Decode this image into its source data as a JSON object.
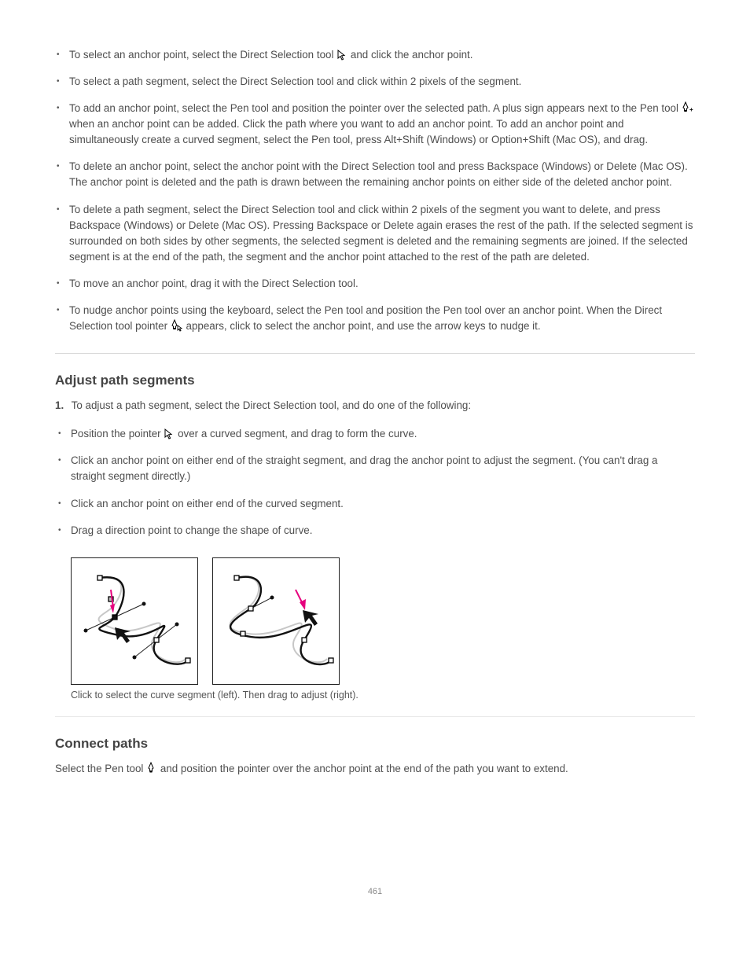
{
  "section1": {
    "b1a": "To select an anchor point, select the Direct Selection tool ",
    "b1b": " and click the anchor point.",
    "b2": "To select a path segment, select the Direct Selection tool and click within 2 pixels of the segment.",
    "b3a": "To add an anchor point, select the Pen tool and position the pointer over the selected path. A plus sign appears next to the Pen tool ",
    "b3b": " when an anchor point can be added. Click the path where you want to add an anchor point. To add an anchor point and simultaneously create a curved segment, select the Pen tool, press Alt+Shift (Windows) or Option+Shift (Mac OS), and drag.",
    "b4": "To delete an anchor point, select the anchor point with the Direct Selection tool and press Backspace (Windows) or Delete (Mac OS). The anchor point is deleted and the path is drawn between the remaining anchor points on either side of the deleted anchor point.",
    "b5": "To delete a path segment, select the Direct Selection tool and click within 2 pixels of the segment you want to delete, and press Backspace (Windows) or Delete (Mac OS). Pressing Backspace or Delete again erases the rest of the path. If the selected segment is surrounded on both sides by other segments, the selected segment is deleted and the remaining segments are joined. If the selected segment is at the end of the path, the segment and the anchor point attached to the rest of the path are deleted.",
    "b6": "To move an anchor point, drag it with the Direct Selection tool.",
    "b7a": "To nudge anchor points using the keyboard, select the Pen tool and position the Pen tool over an anchor point. When the Direct Selection tool pointer ",
    "b7b": " appears, click to select the anchor point, and use the arrow keys to nudge it."
  },
  "section2": {
    "title": "Adjust path segments",
    "intro_num": "1.",
    "intro_text": "To adjust a path segment, select the Direct Selection tool, and do one of the following:",
    "b1a": "Position the pointer ",
    "b1b": " over a curved segment, and drag to form the curve.",
    "b2": "Click an anchor point on either end of the straight segment, and drag the anchor point to adjust the segment. (You can't drag a straight segment directly.)",
    "b3": "Click an anchor point on either end of the curved segment.",
    "b4": "Drag a direction point to change the shape of curve."
  },
  "caption": "Click to select the curve segment (left). Then drag to adjust (right).",
  "section3": {
    "title": "Connect paths",
    "p1a": "Select the Pen tool ",
    "p1b": " and position the pointer over the anchor point at the end of the path you want to extend."
  },
  "page_number": "461"
}
